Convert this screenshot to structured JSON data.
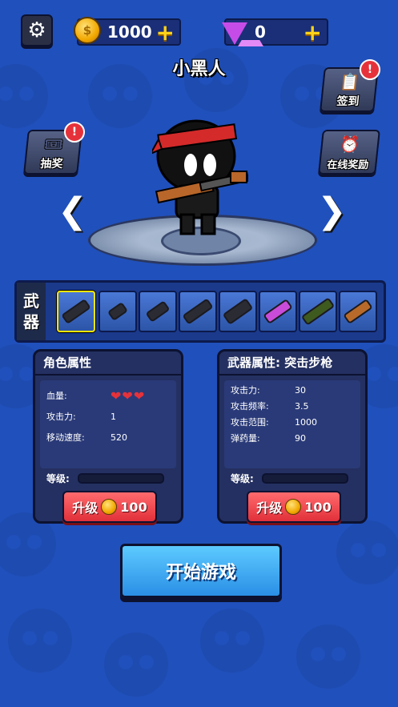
{
  "topbar": {
    "settings_icon": "gear-icon",
    "coins": "1000",
    "gems": "0"
  },
  "character": {
    "name": "小黑人"
  },
  "buttons": {
    "checkin": "签到",
    "lottery": "抽奖",
    "online_reward": "在线奖励"
  },
  "weapons": {
    "label_1": "武",
    "label_2": "器",
    "slots": [
      "assault-rifle",
      "pistol",
      "smg",
      "shotgun",
      "heavy-machine-gun",
      "laser-gun",
      "sniper-rifle",
      "rocket-launcher"
    ]
  },
  "role_panel": {
    "title": "角色属性",
    "rows": [
      {
        "k": "血量:",
        "v": ""
      },
      {
        "k": "攻击力:",
        "v": "1"
      },
      {
        "k": "移动速度:",
        "v": "520"
      }
    ],
    "hearts": "❤❤❤",
    "level_label": "等级:",
    "upgrade_label": "升级",
    "upgrade_cost": "100"
  },
  "weapon_panel": {
    "title": "武器属性: 突击步枪",
    "rows": [
      {
        "k": "攻击力:",
        "v": "30"
      },
      {
        "k": "攻击频率:",
        "v": "3.5"
      },
      {
        "k": "攻击范围:",
        "v": "1000"
      },
      {
        "k": "弹药量:",
        "v": "90"
      }
    ],
    "level_label": "等级:",
    "upgrade_label": "升级",
    "upgrade_cost": "100"
  },
  "start_button": "开始游戏",
  "colors": {
    "background": "#2050bb",
    "start": "#2a8fe6",
    "upgrade": "#e1303a",
    "coin": "#f2a800",
    "gem": "#c64ce8"
  }
}
